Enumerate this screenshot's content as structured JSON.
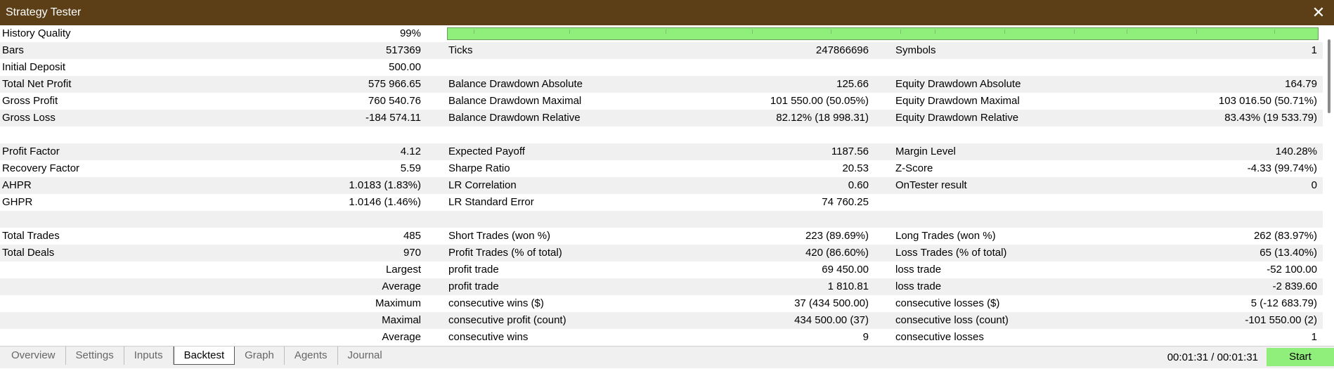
{
  "window": {
    "title": "Strategy Tester",
    "close_icon": "close-icon"
  },
  "history_quality": {
    "label": "History Quality",
    "value": "99%",
    "percent": 99
  },
  "rows": [
    {
      "c1": "Bars",
      "v1": "517369",
      "c2": "Ticks",
      "v2": "247866696",
      "c3": "Symbols",
      "v3": "1"
    },
    {
      "c1": "Initial Deposit",
      "v1": "500.00",
      "c2": "",
      "v2": "",
      "c3": "",
      "v3": ""
    },
    {
      "c1": "Total Net Profit",
      "v1": "575 966.65",
      "c2": "Balance Drawdown Absolute",
      "v2": "125.66",
      "c3": "Equity Drawdown Absolute",
      "v3": "164.79"
    },
    {
      "c1": "Gross Profit",
      "v1": "760 540.76",
      "c2": "Balance Drawdown Maximal",
      "v2": "101 550.00 (50.05%)",
      "c3": "Equity Drawdown Maximal",
      "v3": "103 016.50 (50.71%)"
    },
    {
      "c1": "Gross Loss",
      "v1": "-184 574.11",
      "c2": "Balance Drawdown Relative",
      "v2": "82.12% (18 998.31)",
      "c3": "Equity Drawdown Relative",
      "v3": "83.43% (19 533.79)"
    },
    {
      "c1": "",
      "v1": "",
      "c2": "",
      "v2": "",
      "c3": "",
      "v3": ""
    },
    {
      "c1": "Profit Factor",
      "v1": "4.12",
      "c2": "Expected Payoff",
      "v2": "1187.56",
      "c3": "Margin Level",
      "v3": "140.28%"
    },
    {
      "c1": "Recovery Factor",
      "v1": "5.59",
      "c2": "Sharpe Ratio",
      "v2": "20.53",
      "c3": "Z-Score",
      "v3": "-4.33 (99.74%)"
    },
    {
      "c1": "AHPR",
      "v1": "1.0183 (1.83%)",
      "c2": "LR Correlation",
      "v2": "0.60",
      "c3": "OnTester result",
      "v3": "0"
    },
    {
      "c1": "GHPR",
      "v1": "1.0146 (1.46%)",
      "c2": "LR Standard Error",
      "v2": "74 760.25",
      "c3": "",
      "v3": ""
    },
    {
      "c1": "",
      "v1": "",
      "c2": "",
      "v2": "",
      "c3": "",
      "v3": ""
    },
    {
      "c1": "Total Trades",
      "v1": "485",
      "c2": "Short Trades (won %)",
      "v2": "223 (89.69%)",
      "c3": "Long Trades (won %)",
      "v3": "262 (83.97%)"
    },
    {
      "c1": "Total Deals",
      "v1": "970",
      "c2": "Profit Trades (% of total)",
      "v2": "420 (86.60%)",
      "c3": "Loss Trades (% of total)",
      "v3": "65 (13.40%)"
    },
    {
      "c1": "",
      "v1": "Largest",
      "c2": "profit trade",
      "v2": "69 450.00",
      "c3": "loss trade",
      "v3": "-52 100.00"
    },
    {
      "c1": "",
      "v1": "Average",
      "c2": "profit trade",
      "v2": "1 810.81",
      "c3": "loss trade",
      "v3": "-2 839.60"
    },
    {
      "c1": "",
      "v1": "Maximum",
      "c2": "consecutive wins ($)",
      "v2": "37 (434 500.00)",
      "c3": "consecutive losses ($)",
      "v3": "5 (-12 683.79)"
    },
    {
      "c1": "",
      "v1": "Maximal",
      "c2": "consecutive profit (count)",
      "v2": "434 500.00 (37)",
      "c3": "consecutive loss (count)",
      "v3": "-101 550.00 (2)"
    },
    {
      "c1": "",
      "v1": "Average",
      "c2": "consecutive wins",
      "v2": "9",
      "c3": "consecutive losses",
      "v3": "1"
    }
  ],
  "tabs": [
    {
      "label": "Overview",
      "active": false
    },
    {
      "label": "Settings",
      "active": false
    },
    {
      "label": "Inputs",
      "active": false
    },
    {
      "label": "Backtest",
      "active": true
    },
    {
      "label": "Graph",
      "active": false
    },
    {
      "label": "Agents",
      "active": false
    },
    {
      "label": "Journal",
      "active": false
    }
  ],
  "footer": {
    "timer": "00:01:31 / 00:01:31",
    "start_label": "Start"
  },
  "colors": {
    "titlebar": "#5c3f16",
    "accent_green": "#90ee7a",
    "row_shade": "#f0f0f0"
  }
}
